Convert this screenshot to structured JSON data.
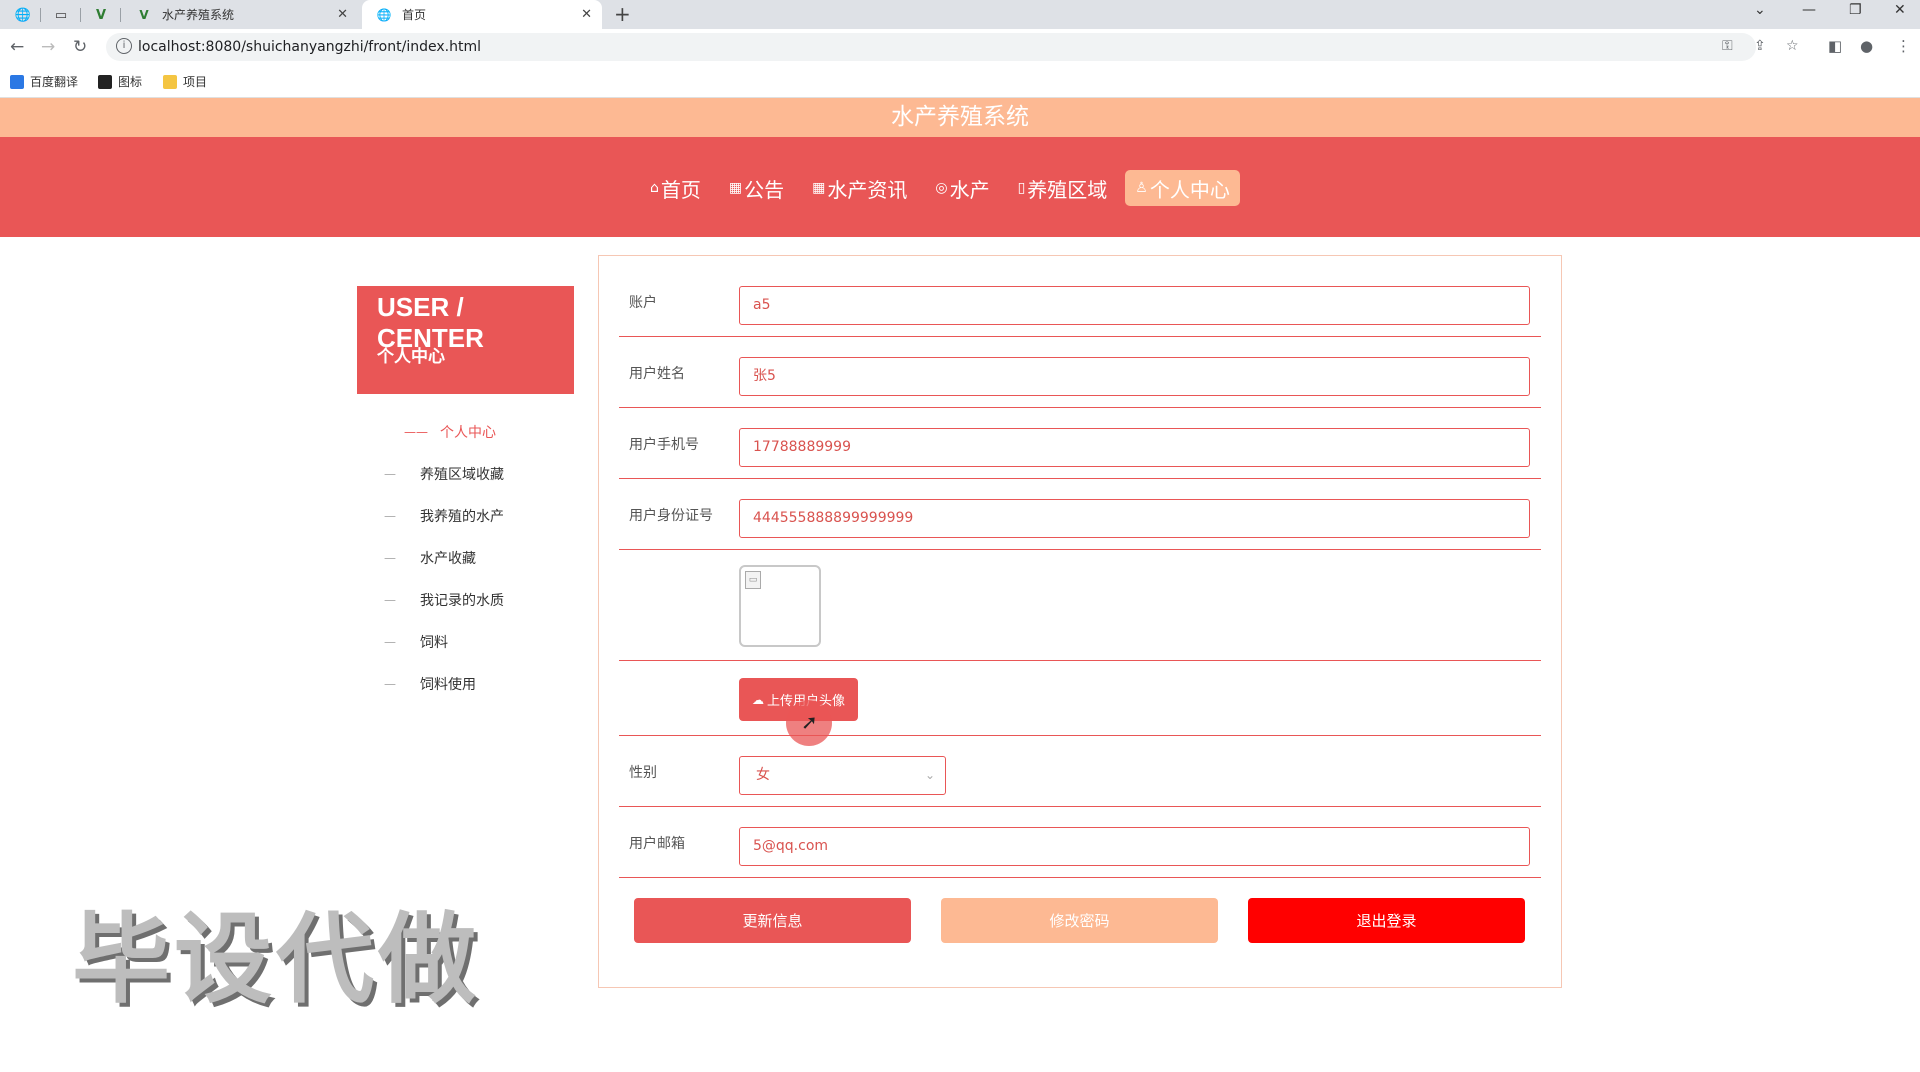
{
  "browser": {
    "tabs": [
      {
        "title": "水产养殖系统",
        "active": false
      },
      {
        "title": "首页",
        "active": true
      }
    ],
    "url": "localhost:8080/shuichanyangzhi/front/index.html",
    "bookmarks": [
      "百度翻译",
      "图标",
      "项目"
    ]
  },
  "site": {
    "title": "水产养殖系统",
    "nav": [
      {
        "label": "首页",
        "icon": "home-icon",
        "glyph": "⌂"
      },
      {
        "label": "公告",
        "icon": "notice-icon",
        "glyph": "▦"
      },
      {
        "label": "水产资讯",
        "icon": "grid-icon",
        "glyph": "▦"
      },
      {
        "label": "水产",
        "icon": "fish-icon",
        "glyph": "◎"
      },
      {
        "label": "养殖区域",
        "icon": "area-icon",
        "glyph": "▯"
      },
      {
        "label": "个人中心",
        "icon": "user-icon",
        "glyph": "♙"
      }
    ],
    "accent": "#e95656",
    "accent_light": "#fdb993"
  },
  "sidebar": {
    "heading_en": "USER / CENTER",
    "heading_cn": "个人中心",
    "items": [
      "个人中心",
      "养殖区域收藏",
      "我养殖的水产",
      "水产收藏",
      "我记录的水质",
      "饲料",
      "饲料使用"
    ]
  },
  "form": {
    "account_label": "账户",
    "account_value": "a5",
    "name_label": "用户姓名",
    "name_value": "张5",
    "phone_label": "用户手机号",
    "phone_value": "17788889999",
    "idcard_label": "用户身份证号",
    "idcard_value": "444555888899999999",
    "upload_label": "上传用户头像",
    "gender_label": "性别",
    "gender_value": "女",
    "email_label": "用户邮箱",
    "email_value": "5@qq.com"
  },
  "actions": {
    "update": "更新信息",
    "change_password": "修改密码",
    "logout": "退出登录"
  },
  "watermark": "毕设代做"
}
